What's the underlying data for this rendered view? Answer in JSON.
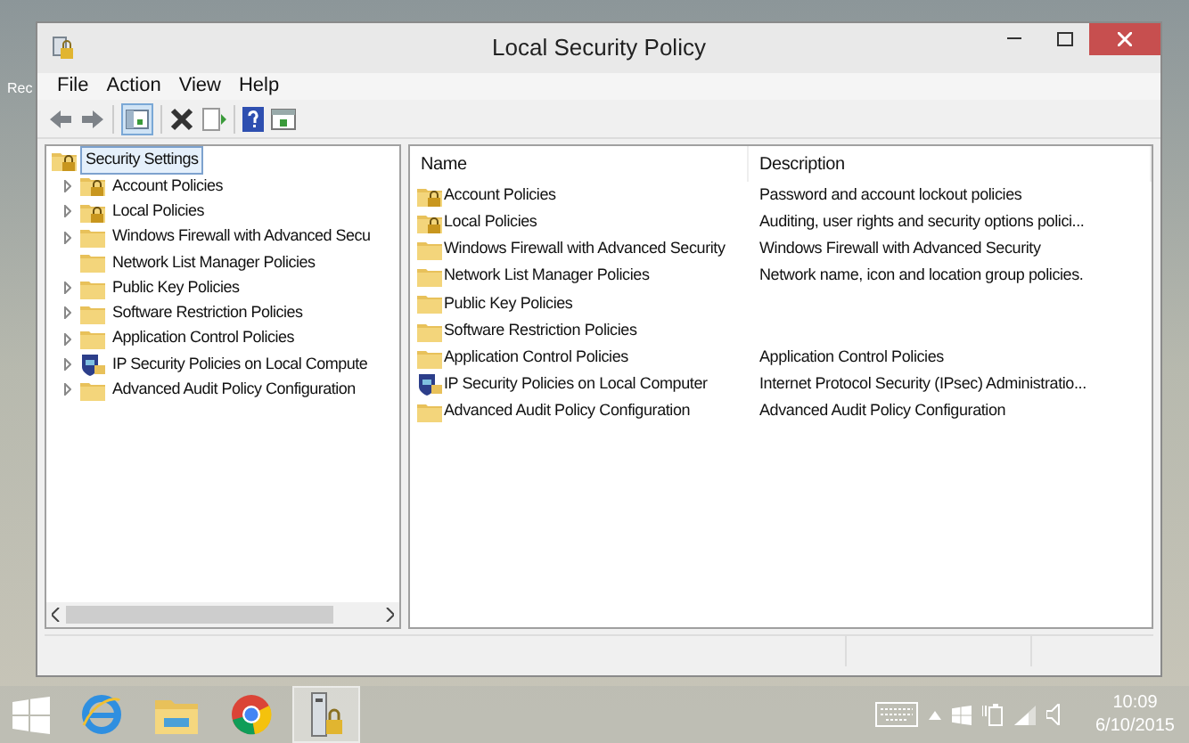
{
  "desktop": {
    "icon_label": "Rec"
  },
  "window": {
    "title": "Local Security Policy"
  },
  "menu": [
    "File",
    "Action",
    "View",
    "Help"
  ],
  "tree": {
    "label": "Security Settings",
    "kind": "lock-folder",
    "selected": true,
    "children": [
      {
        "label": "Account Policies",
        "kind": "lock-folder",
        "expandable": true,
        "selected": false
      },
      {
        "label": "Local Policies",
        "kind": "lock-folder",
        "expandable": true,
        "selected": false
      },
      {
        "label": "Windows Firewall with Advanced Secu",
        "kind": "folder",
        "expandable": true,
        "selected": false
      },
      {
        "label": "Network List Manager Policies",
        "kind": "folder",
        "expandable": false,
        "selected": false
      },
      {
        "label": "Public Key Policies",
        "kind": "folder",
        "expandable": true,
        "selected": false
      },
      {
        "label": "Software Restriction Policies",
        "kind": "folder",
        "expandable": true,
        "selected": false
      },
      {
        "label": "Application Control Policies",
        "kind": "folder",
        "expandable": true,
        "selected": false
      },
      {
        "label": "IP Security Policies on Local Compute",
        "kind": "shield",
        "expandable": true,
        "selected": false
      },
      {
        "label": "Advanced Audit Policy Configuration",
        "kind": "folder",
        "expandable": true,
        "selected": false
      }
    ]
  },
  "list": {
    "columns": [
      "Name",
      "Description"
    ],
    "rows": [
      {
        "name": "Account Policies",
        "kind": "lock-folder",
        "description": "Password and account lockout policies"
      },
      {
        "name": "Local Policies",
        "kind": "lock-folder",
        "description": "Auditing, user rights and security options polici..."
      },
      {
        "name": "Windows Firewall with Advanced Security",
        "kind": "folder",
        "description": "Windows Firewall with Advanced Security"
      },
      {
        "name": "Network List Manager Policies",
        "kind": "folder",
        "description": "Network name, icon and location group policies."
      },
      {
        "name": "Public Key Policies",
        "kind": "folder"
      },
      {
        "name": "Software Restriction Policies",
        "kind": "folder"
      },
      {
        "name": "Application Control Policies",
        "kind": "folder",
        "description": "Application Control Policies"
      },
      {
        "name": "IP Security Policies on Local Computer",
        "kind": "shield",
        "description": "Internet Protocol Security (IPsec) Administratio..."
      },
      {
        "name": "Advanced Audit Policy Configuration",
        "kind": "folder",
        "description": "Advanced Audit Policy Configuration"
      }
    ]
  },
  "taskbar": {
    "apps": [
      {
        "kind": "browser-e",
        "selected": false
      },
      {
        "kind": "explorer",
        "selected": false
      },
      {
        "kind": "chrome",
        "selected": false
      },
      {
        "kind": "policy",
        "selected": true
      }
    ],
    "time": "10:09",
    "date": "6/10/2015"
  }
}
